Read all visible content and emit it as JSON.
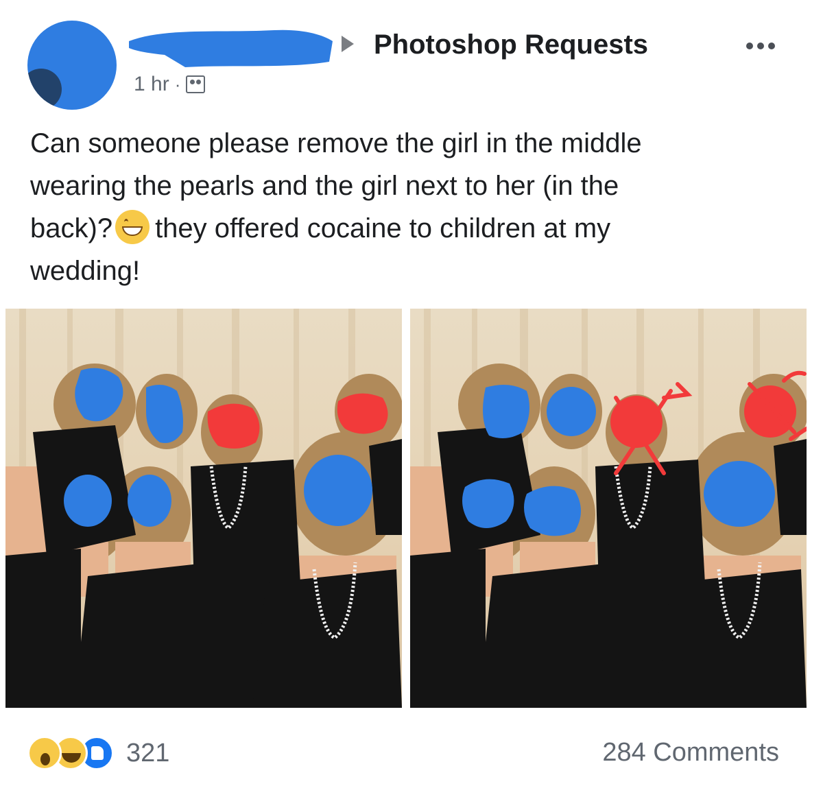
{
  "post": {
    "group_name": "Photoshop Requests",
    "time": "1 hr",
    "separator": "·",
    "audience_icon": "group-icon",
    "text_line1": "Can someone please remove the girl in the middle",
    "text_line2": "wearing the pearls and the girl next to her (in the",
    "text_line3a": "back)?",
    "emoji": "grinning-face-icon",
    "text_line3b": "they offered cocaine to children at my",
    "text_line4": "wedding!"
  },
  "footer": {
    "reaction_icons": [
      "wow-icon",
      "haha-icon",
      "like-icon"
    ],
    "reaction_count": "321",
    "comments": "284 Comments"
  },
  "colors": {
    "redaction_blue": "#2f7de1",
    "mark_red": "#f23a3a",
    "link": "#1c1e21",
    "secondary": "#606770"
  }
}
